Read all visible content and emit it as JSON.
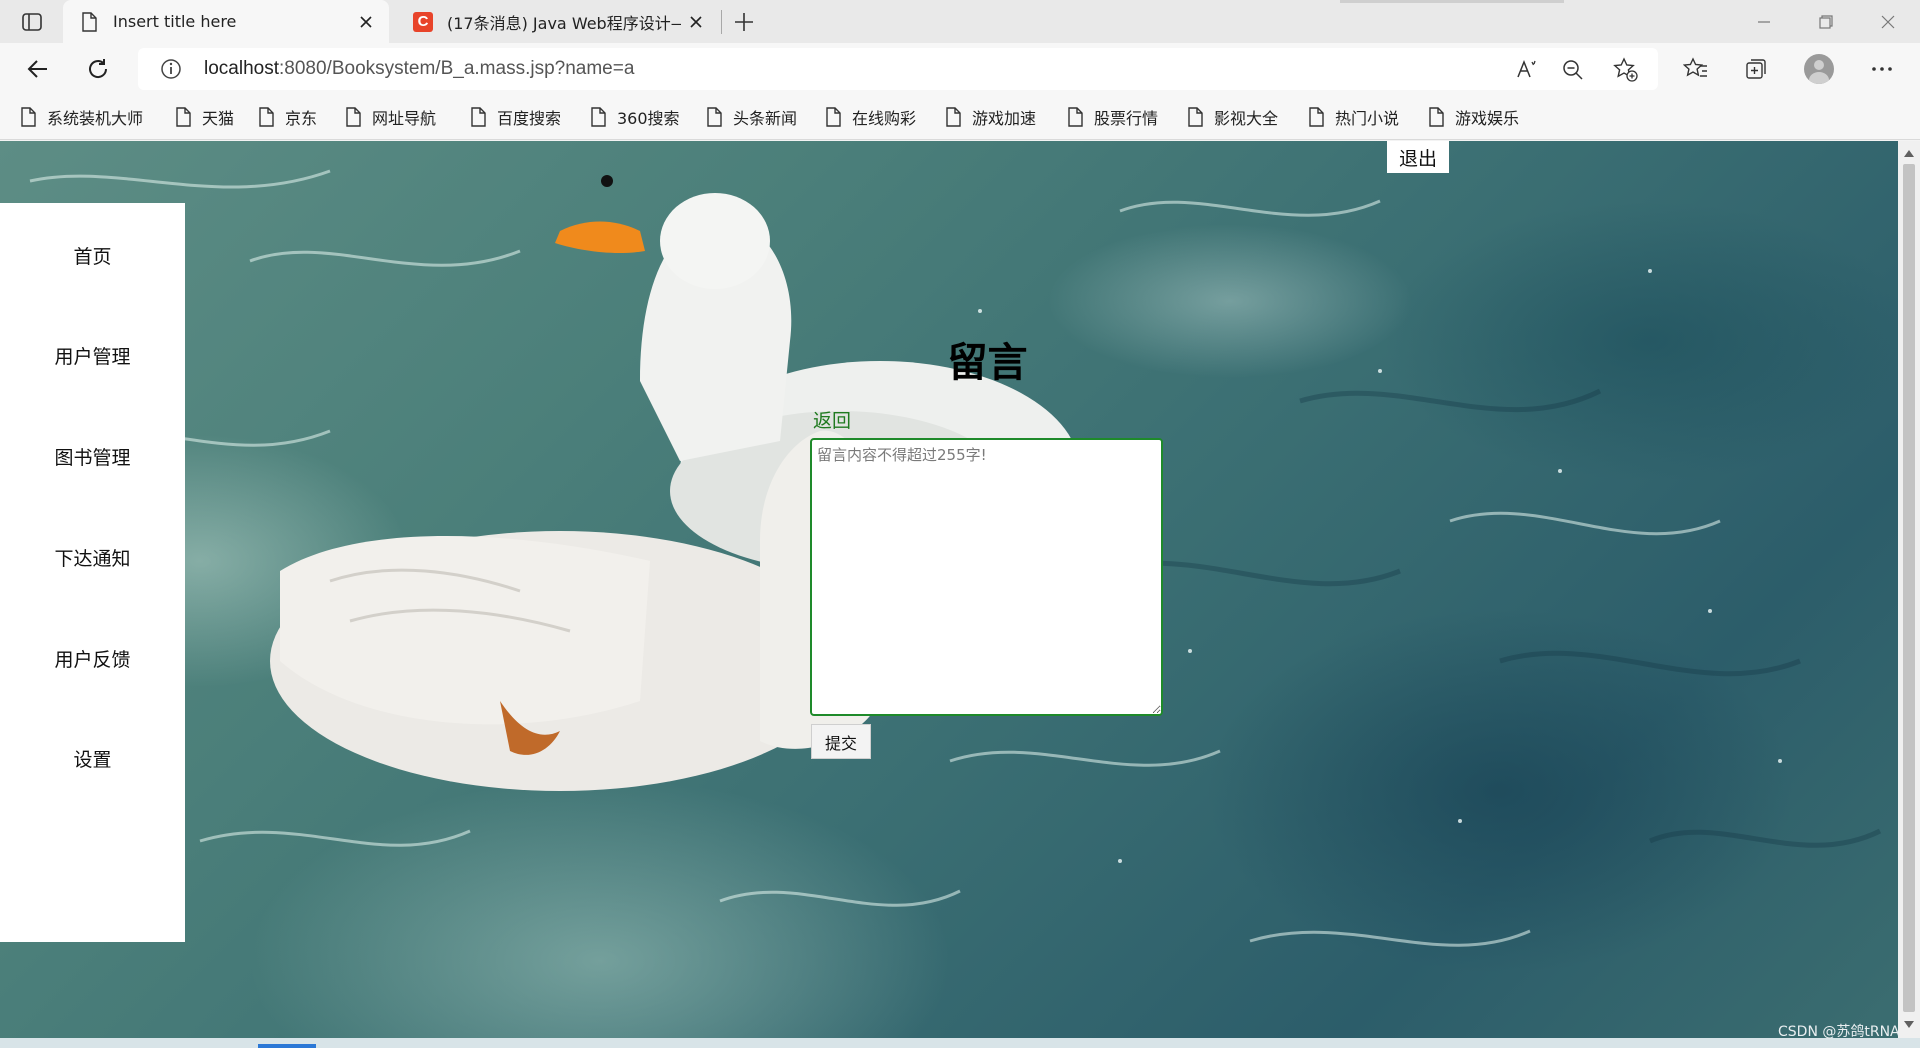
{
  "browser": {
    "tabs": [
      {
        "title": "Insert title here",
        "active": true
      },
      {
        "title": "(17条消息) Java Web程序设计—",
        "active": false
      }
    ],
    "address_url_host": "localhost",
    "address_url_rest": ":8080/Booksystem/B_a.mass.jsp?name=a",
    "bookmarks": [
      "系统装机大师",
      "天猫",
      "京东",
      "网址导航",
      "百度搜索",
      "360搜索",
      "头条新闻",
      "在线购彩",
      "游戏加速",
      "股票行情",
      "影视大全",
      "热门小说",
      "游戏娱乐"
    ]
  },
  "page": {
    "sidebar": [
      "首页",
      "用户管理",
      "图书管理",
      "下达通知",
      "用户反馈",
      "设置"
    ],
    "logout_label": "退出",
    "heading": "留言",
    "back_label": "返回",
    "textarea_placeholder": "留言内容不得超过255字!",
    "submit_label": "提交",
    "watermark": "CSDN @苏鸽tRNA"
  },
  "colors": {
    "accent_green": "#1e8a2a",
    "csdn_red": "#e8442a"
  }
}
